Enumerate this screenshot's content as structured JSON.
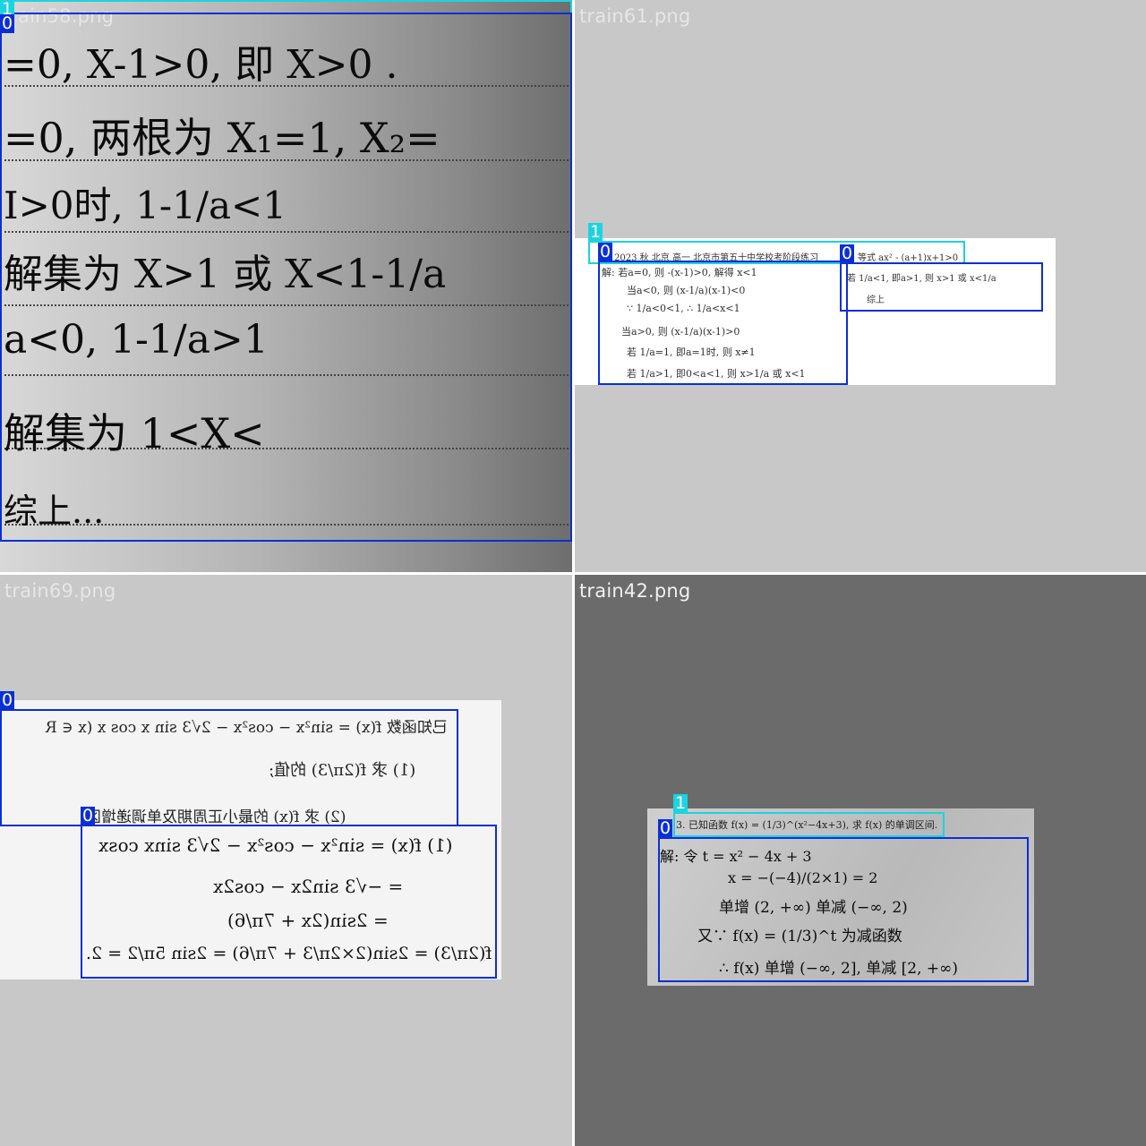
{
  "tiles": [
    {
      "filename": "train58.png",
      "filename_visible": "ain58.png",
      "boxes": [
        {
          "label": "1"
        },
        {
          "label": "0"
        }
      ],
      "handwriting": [
        "=0, X-1>0, 即 X>0 .",
        "=0, 两根为 X₁=1, X₂=",
        "I>0时, 1-1/a<1",
        "解集为 X>1 或 X<1-1/a",
        "a<0, 1-1/a>1",
        "解集为 1<X<",
        "综上..."
      ]
    },
    {
      "filename": "train61.png",
      "boxes": [
        {
          "label": "1"
        },
        {
          "label": "0"
        },
        {
          "label": "0"
        }
      ],
      "header": "2023 秋 北京 高一 北京市第五十中学校考阶段练习",
      "header_right": "等式 ax² - (a+1)x+1>0",
      "lines_left": [
        "解: 若a=0, 则 -(x-1)>0, 解得 x<1",
        "当a<0, 则 (x-1/a)(x-1)<0",
        "∵ 1/a<0<1, ∴ 1/a<x<1",
        "当a>0, 则 (x-1/a)(x-1)>0",
        "若 1/a=1, 即a=1时, 则 x≠1",
        "若 1/a>1, 即0<a<1, 则 x>1/a 或 x<1"
      ],
      "lines_right": [
        "若 1/a<1, 即a>1, 则 x>1 或 x<1/a",
        "综上"
      ]
    },
    {
      "filename": "train69.png",
      "boxes": [
        {
          "label": "0"
        },
        {
          "label": "0"
        }
      ],
      "problem": [
        "已知函数 f(x) = sin²x − cos²x − 2√3 sin x cos x (x ∈ R",
        "(1) 求 f(2π/3) 的值;",
        "(2) 求 f(x) 的最小正周期及单调递增区"
      ],
      "solution": [
        "(1) f(x) = sin²x − cos²x − 2√3 sinx cosx",
        "= −√3 sin2x − cos2x",
        "= 2sin(2x + 7π/6)",
        "f(2π/3) = 2sin(2×2π/3 + 7π/6) = 2sin 5π/2 = 2."
      ]
    },
    {
      "filename": "train42.png",
      "boxes": [
        {
          "label": "1"
        },
        {
          "label": "0"
        }
      ],
      "problem": "3. 已知函数 f(x) = (1/3)^(x²−4x+3), 求 f(x) 的单调区间.",
      "solution": [
        "解: 令 t = x² − 4x + 3",
        "x = −(−4)/(2×1) = 2",
        "单增 (2, +∞)  单减 (−∞, 2)",
        "又∵ f(x) = (1/3)^t 为减函数",
        "∴ f(x) 单增 (−∞, 2], 单减 [2, +∞)"
      ]
    }
  ],
  "colors": {
    "class0": "#0a2fd6",
    "class1": "#1cd3e0",
    "tile_bg": "#c8c8c8",
    "tile_bg_dark": "#6b6b6b"
  }
}
